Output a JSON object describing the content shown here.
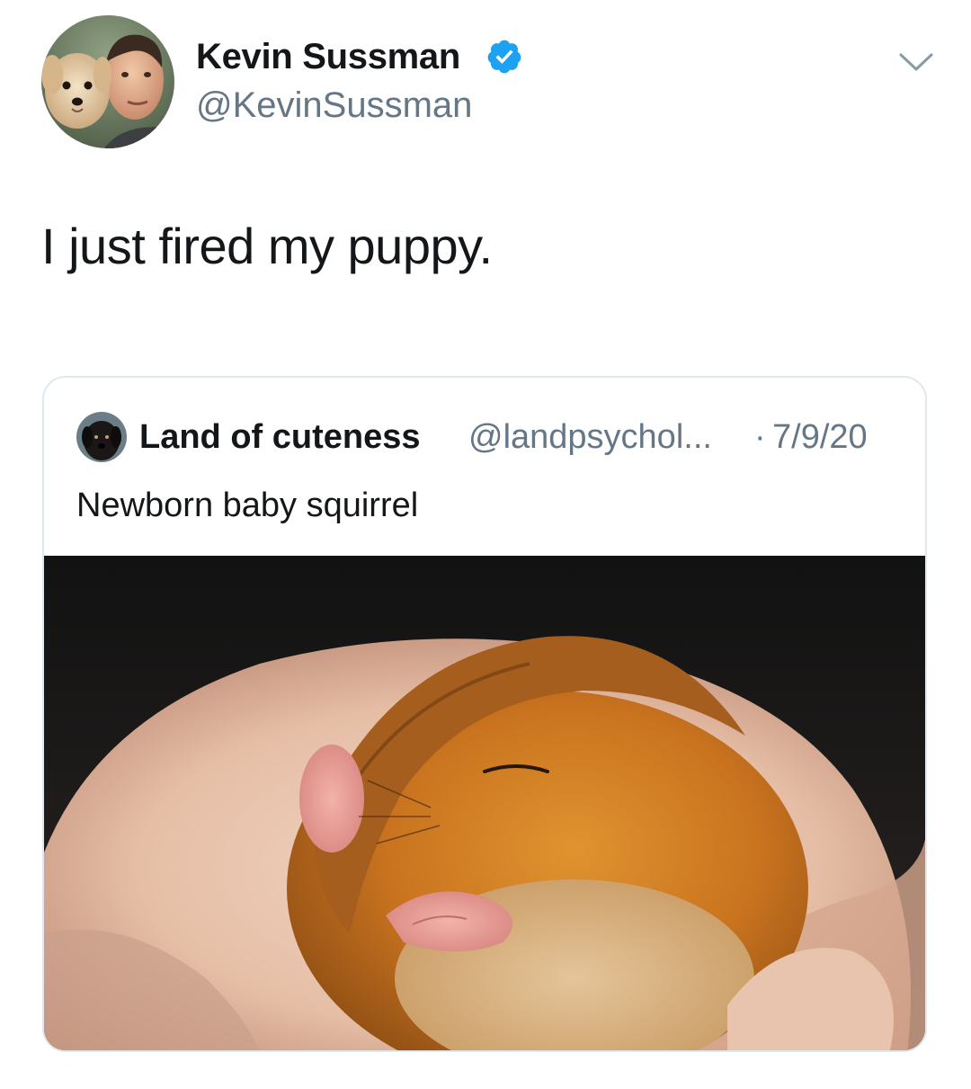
{
  "author": {
    "name": "Kevin Sussman",
    "handle": "@KevinSussman",
    "verified": true,
    "avatar_icon": "profile-photo-man-with-dog"
  },
  "tweet": {
    "text": "I just fired my puppy."
  },
  "quoted_tweet": {
    "name": "Land of cuteness",
    "handle": "@landpsychol...",
    "separator": "·",
    "date": "7/9/20",
    "text": "Newborn baby squirrel",
    "avatar_icon": "black-dog-avatar",
    "media_icon": "photo-sleeping-baby-dormouse-in-hand"
  },
  "colors": {
    "text_primary": "#14171a",
    "text_secondary": "#657786",
    "verified_blue": "#1da1f2",
    "card_border": "#e1e8ed"
  }
}
